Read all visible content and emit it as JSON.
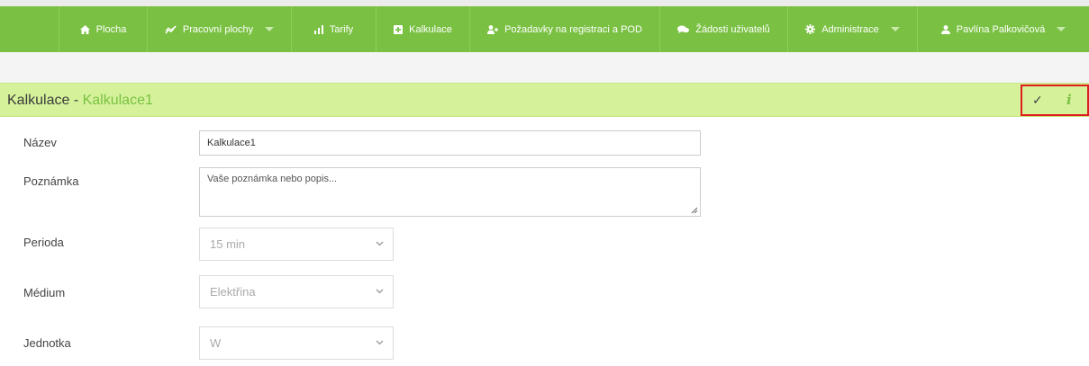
{
  "nav": {
    "items": [
      {
        "label": "Plocha",
        "icon": "home-icon"
      },
      {
        "label": "Pracovní plochy",
        "icon": "chart-line-icon",
        "dropdown": true
      },
      {
        "label": "Tarify",
        "icon": "bar-chart-icon"
      },
      {
        "label": "Kalkulace",
        "icon": "plus-square-icon"
      },
      {
        "label": "Požadavky na registraci a POD",
        "icon": "user-add-icon"
      },
      {
        "label": "Žádosti uživatelů",
        "icon": "comments-icon"
      },
      {
        "label": "Administrace",
        "icon": "gear-icon",
        "dropdown": true
      },
      {
        "label": "Pavlína Palkovičová",
        "icon": "user-icon",
        "dropdown": true
      }
    ]
  },
  "header": {
    "title": "Kalkulace",
    "separator": " - ",
    "subtitle": "Kalkulace1",
    "actions": {
      "save_icon": "check-icon",
      "info_icon": "info-icon",
      "save_glyph": "✓",
      "info_glyph": "i"
    }
  },
  "form": {
    "name_label": "Název",
    "name_value": "Kalkulace1",
    "note_label": "Poznámka",
    "note_placeholder": "Vaše poznámka nebo popis...",
    "period_label": "Perioda",
    "period_value": "15 min",
    "medium_label": "Médium",
    "medium_value": "Elektřina",
    "unit_label": "Jednotka",
    "unit_value": "W"
  },
  "colors": {
    "nav_bg": "#7ac143",
    "title_bg": "#d5f29a",
    "accent": "#7ac143",
    "highlight_border": "#e01d1d"
  }
}
